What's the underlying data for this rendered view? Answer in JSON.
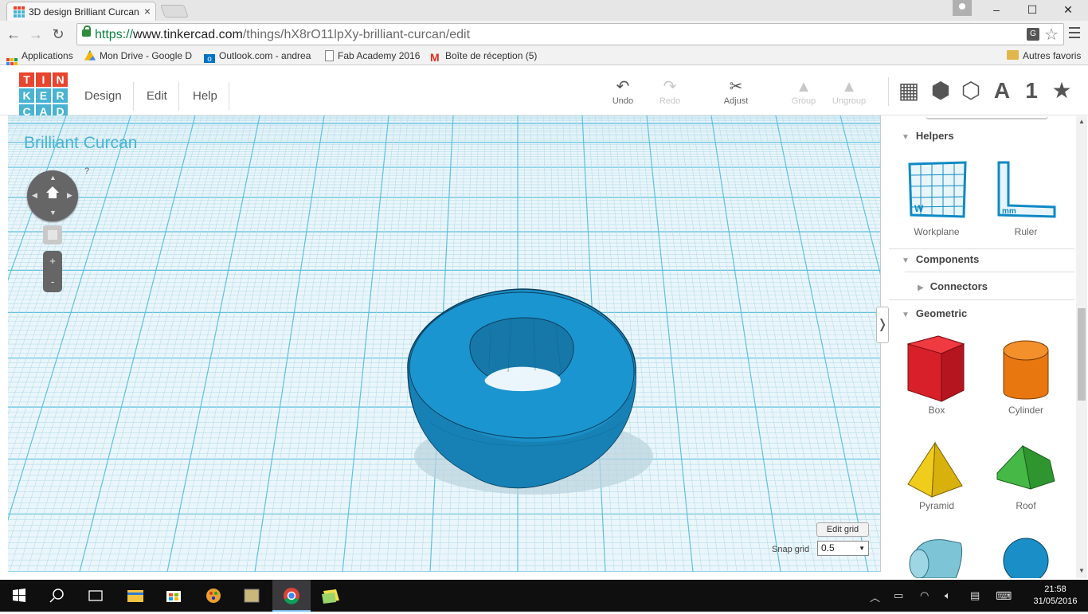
{
  "browser": {
    "tab_title": "3D design Brilliant Curcan",
    "tab_close": "×",
    "url_scheme": "https://",
    "url_host": "www.tinkercad.com",
    "url_path": "/things/hX8rO11lpXy-brilliant-curcan/edit",
    "window_controls": {
      "minimize": "–",
      "maximize": "☐",
      "close": "✕"
    },
    "nav": {
      "back": "←",
      "forward": "→",
      "reload": "↻"
    },
    "bookmarks": [
      {
        "label": "Applications",
        "icon": "apps-icon"
      },
      {
        "label": "Mon Drive - Google D",
        "icon": "drive-icon"
      },
      {
        "label": "Outlook.com - andrea",
        "icon": "outlook-icon"
      },
      {
        "label": "Fab Academy 2016",
        "icon": "page-icon"
      },
      {
        "label": "Boîte de réception (5)",
        "icon": "gmail-icon"
      }
    ],
    "other_bookmarks": "Autres favoris"
  },
  "tinkercad": {
    "logo_letters": [
      "T",
      "I",
      "N",
      "K",
      "E",
      "R",
      "C",
      "A",
      "D"
    ],
    "logo_colors": [
      "#e8442e",
      "#e8442e",
      "#e8442e",
      "#49b3d4",
      "#49b3d4",
      "#49b3d4",
      "#49b3d4",
      "#49b3d4",
      "#49b3d4"
    ],
    "menus": [
      "Design",
      "Edit",
      "Help"
    ],
    "tools": [
      {
        "label": "Undo",
        "icon": "undo-icon",
        "glyph": "↶",
        "enabled": true
      },
      {
        "label": "Redo",
        "icon": "redo-icon",
        "glyph": "↷",
        "enabled": false
      },
      {
        "label": "Adjust",
        "icon": "adjust-icon",
        "glyph": "✂",
        "enabled": true
      },
      {
        "label": "Group",
        "icon": "group-icon",
        "glyph": "▲",
        "enabled": false
      },
      {
        "label": "Ungroup",
        "icon": "ungroup-icon",
        "glyph": "▲",
        "enabled": false
      }
    ],
    "view_icons": [
      {
        "name": "grid-view-icon",
        "glyph": "▦"
      },
      {
        "name": "cube-view-icon",
        "glyph": "⬢"
      },
      {
        "name": "wireframe-view-icon",
        "glyph": "⬡"
      },
      {
        "name": "text-icon",
        "glyph": "A"
      },
      {
        "name": "number-icon",
        "glyph": "1"
      },
      {
        "name": "favorites-icon",
        "glyph": "★"
      }
    ],
    "design_title": "Brilliant Curcan",
    "help_mark": "?",
    "zoom_in": "+",
    "zoom_out": "-",
    "edit_grid": "Edit grid",
    "snap_grid_label": "Snap grid",
    "snap_grid_value": "0.5",
    "collapse_glyph": "❭",
    "panel": {
      "helpers_title": "Helpers",
      "helpers": [
        {
          "label": "Workplane",
          "mark": "W"
        },
        {
          "label": "Ruler",
          "mark": "mm"
        }
      ],
      "components_title": "Components",
      "connectors_title": "Connectors",
      "geometric_title": "Geometric",
      "shapes": [
        {
          "label": "Box",
          "color": "#d8202a"
        },
        {
          "label": "Cylinder",
          "color": "#e8770f"
        },
        {
          "label": "Pyramid",
          "color": "#e8c20f"
        },
        {
          "label": "Roof",
          "color": "#3aa63a"
        }
      ]
    },
    "object_color": "#1a8fc7"
  },
  "taskbar": {
    "time": "21:58",
    "date": "31/05/2016"
  }
}
